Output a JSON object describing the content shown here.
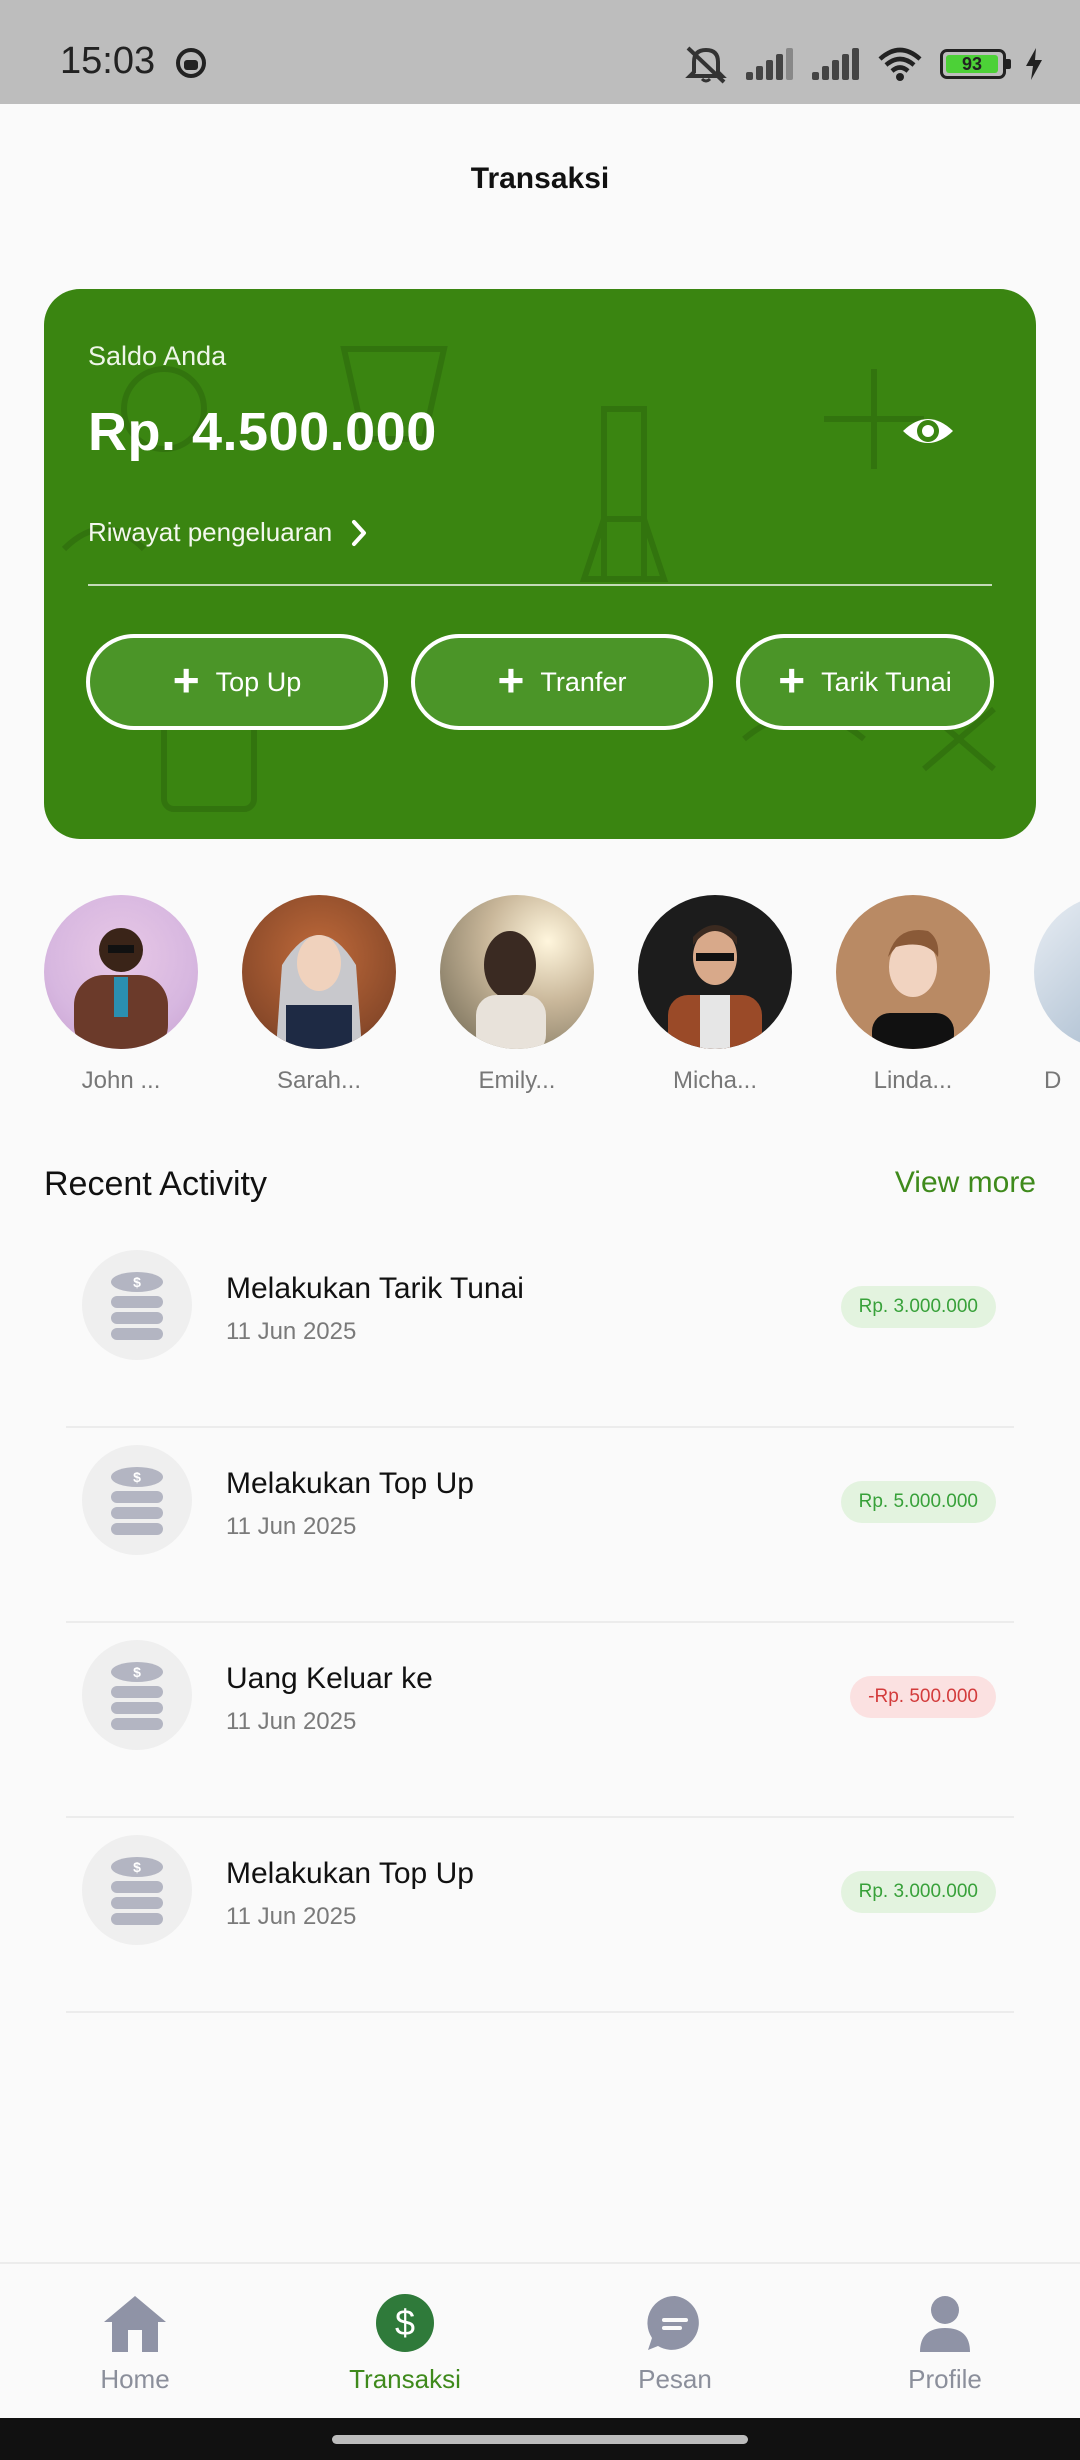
{
  "status_bar": {
    "time": "15:03",
    "battery": "93"
  },
  "header": {
    "title": "Transaksi"
  },
  "balance_card": {
    "label": "Saldo Anda",
    "amount": "Rp. 4.500.000",
    "history_link": "Riwayat pengeluaran",
    "actions": [
      {
        "label": "Top Up",
        "icon": "plus-icon"
      },
      {
        "label": "Tranfer",
        "icon": "plus-icon"
      },
      {
        "label": "Tarik Tunai",
        "icon": "plus-icon"
      }
    ],
    "card_color": "#3a8511"
  },
  "contacts": [
    {
      "name": "John ..."
    },
    {
      "name": "Sarah..."
    },
    {
      "name": "Emily..."
    },
    {
      "name": "Micha..."
    },
    {
      "name": "Linda..."
    },
    {
      "name": "D"
    }
  ],
  "recent_activity": {
    "title": "Recent Activity",
    "view_more": "View more",
    "items": [
      {
        "title": "Melakukan Tarik Tunai",
        "date": "11 Jun 2025",
        "amount": "Rp. 3.000.000",
        "type": "positive"
      },
      {
        "title": "Melakukan Top Up",
        "date": "11 Jun 2025",
        "amount": "Rp. 5.000.000",
        "type": "positive"
      },
      {
        "title": "Uang Keluar ke",
        "date": "11 Jun 2025",
        "amount": "-Rp. 500.000",
        "type": "negative"
      },
      {
        "title": "Melakukan Top Up",
        "date": "11 Jun 2025",
        "amount": "Rp. 3.000.000",
        "type": "positive"
      }
    ]
  },
  "bottom_nav": {
    "items": [
      {
        "label": "Home",
        "icon": "home-icon"
      },
      {
        "label": "Transaksi",
        "icon": "dollar-icon",
        "active": true
      },
      {
        "label": "Pesan",
        "icon": "chat-icon"
      },
      {
        "label": "Profile",
        "icon": "person-icon"
      }
    ],
    "accent": "#3f8a1c"
  }
}
